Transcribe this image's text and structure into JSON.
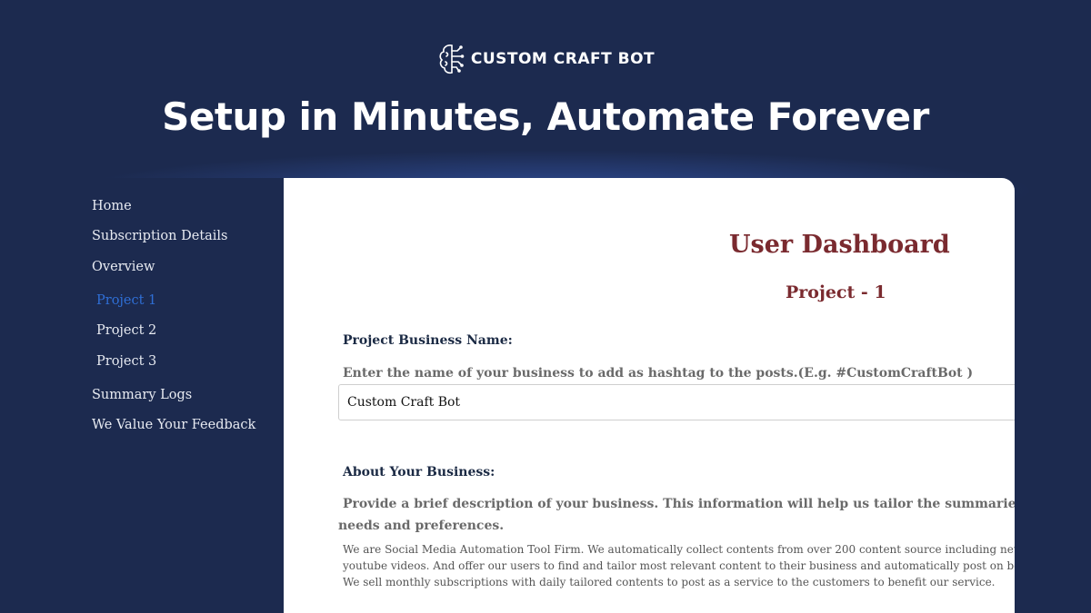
{
  "brand": {
    "name": "CUSTOM CRAFT BOT",
    "logo_icon": "brain-circuit-icon"
  },
  "hero": {
    "headline": "Setup in Minutes, Automate Forever"
  },
  "sidebar": {
    "items": [
      {
        "label": "Home"
      },
      {
        "label": "Subscription Details"
      },
      {
        "label": "Overview"
      },
      {
        "label": "Project 1",
        "active": true
      },
      {
        "label": "Project 2"
      },
      {
        "label": "Project 3"
      },
      {
        "label": "Summary Logs"
      },
      {
        "label": "We Value Your Feedback"
      }
    ]
  },
  "main": {
    "title": "User Dashboard",
    "project_title": "Project - 1",
    "business_name": {
      "label": "Project Business Name:",
      "hint": "Enter the name of your business to add as hashtag to the posts.(E.g. #CustomCraftBot )",
      "value": "Custom Craft Bot"
    },
    "about": {
      "label": "About Your Business:",
      "hint_line1": "Provide a brief description of your business. This information will help us tailor the summaries to be",
      "hint_line2": "needs and preferences.",
      "value_lines": [
        "We are Social Media Automation Tool Firm. We automatically collect contents from over 200 content source including news",
        "youtube videos. And offer our users to find and tailor most relevant content to their business and automatically post on beh",
        "We sell monthly subscriptions with daily tailored contents to post as a service to the customers to benefit our service."
      ]
    }
  },
  "colors": {
    "background": "#1c2a4f",
    "accent_title": "#7a2a2f",
    "active_link": "#2f6fd6"
  }
}
